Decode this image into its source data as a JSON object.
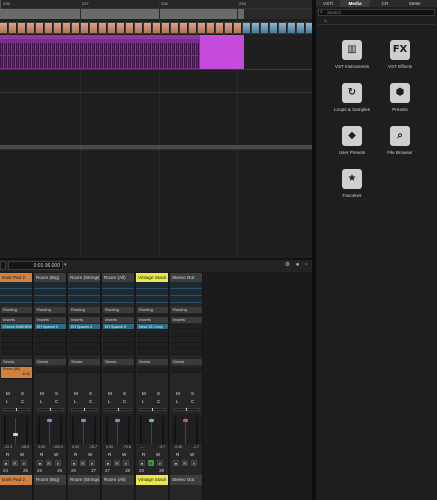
{
  "ruler": {
    "marks": [
      "236",
      "237",
      "238",
      "239"
    ]
  },
  "mixer": {
    "time_display": "0:01:36.000",
    "channels": [
      {
        "name": "Dark Pad 2",
        "color": "orange",
        "insert": "Chorus DIMENSION ...",
        "send_name": "Room (All)",
        "send_value": "-6.40",
        "mute": "M",
        "solo": "S",
        "l": "L",
        "center": "C",
        "val_a": "-12.3",
        "val_b": "-28.9",
        "read": "R",
        "write": "W",
        "num": "24",
        "num_val": "25",
        "footer": "Dark Pad 2"
      },
      {
        "name": "Room (Big)",
        "color": "gray",
        "insert": "EH Spaces II",
        "send_name": "",
        "send_value": "",
        "mute": "M",
        "solo": "S",
        "l": "L",
        "center": "C",
        "val_a": "0.00",
        "val_b": "-104.0",
        "read": "R",
        "write": "W",
        "num": "25",
        "num_val": "26",
        "footer": "Room (Big)"
      },
      {
        "name": "Room (Strings)",
        "color": "gray",
        "insert": "EH Spaces II",
        "send_name": "",
        "send_value": "",
        "mute": "M",
        "solo": "S",
        "l": "L",
        "center": "C",
        "val_a": "0.00",
        "val_b": "-78.7",
        "read": "R",
        "write": "W",
        "num": "26",
        "num_val": "27",
        "footer": "Room (Strings)"
      },
      {
        "name": "Room (All)",
        "color": "gray",
        "insert": "EH Spaces II",
        "send_name": "",
        "send_value": "",
        "mute": "M",
        "solo": "S",
        "l": "L",
        "center": "C",
        "val_a": "0.00",
        "val_b": "-70.8",
        "read": "R",
        "write": "W",
        "num": "27",
        "num_val": "28",
        "footer": "Room (All)"
      },
      {
        "name": "Vintage Stack",
        "color": "yellow",
        "insert": "Neve 33 Comp",
        "send_name": "",
        "send_value": "",
        "mute": "M",
        "solo": "S",
        "l": "L",
        "center": "C",
        "val_a": "---",
        "val_b": "-3.7",
        "read": "R",
        "write": "W",
        "num": "28",
        "num_val": "29",
        "footer": "Vintage Stack"
      },
      {
        "name": "Stereo Out",
        "color": "gray",
        "insert": "",
        "send_name": "",
        "send_value": "",
        "mute": "M",
        "solo": "S",
        "l": "L",
        "center": "C",
        "val_a": "-0.40",
        "val_b": "-1.7",
        "read": "R",
        "write": "W",
        "num": "",
        "num_val": "",
        "footer": "Stereo Out"
      }
    ],
    "section_labels": {
      "routing": "Routing",
      "inserts": "Inserts",
      "sends": "Sends"
    }
  },
  "media": {
    "tabs": [
      "VSTi",
      "Media",
      "CR",
      "Meter"
    ],
    "active_tab": "Media",
    "search_placeholder": "Search",
    "tiles": [
      {
        "label": "VST Instruments",
        "icon": "piano-keys-icon"
      },
      {
        "label": "VST Effects",
        "icon": "fx-icon"
      },
      {
        "label": "Loops & Samples",
        "icon": "loop-icon"
      },
      {
        "label": "Presets",
        "icon": "presets-icon"
      },
      {
        "label": "User Presets",
        "icon": "user-presets-icon"
      },
      {
        "label": "File Browser",
        "icon": "file-browser-icon"
      },
      {
        "label": "Favorites",
        "icon": "star-icon"
      }
    ],
    "tile_glyphs": [
      "▥",
      "FX",
      "↻",
      "⬢",
      "◆",
      "⌕",
      "★"
    ]
  },
  "colors": {
    "event_purple": "#7a2c8a",
    "event_magenta": "#c44bdc",
    "channel_orange": "#d0813f",
    "channel_yellow": "#e8e84a",
    "insert_teal": "#2b6f86",
    "record_red": "#d83434",
    "read_green": "#44a844"
  }
}
